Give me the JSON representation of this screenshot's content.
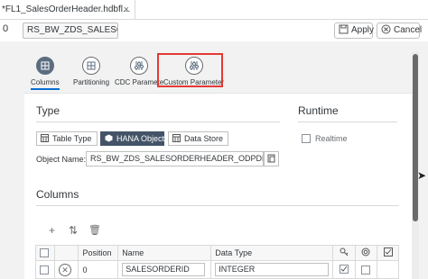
{
  "tab": {
    "title": "*FL1_SalesOrderHeader.hdbfl...",
    "close": "×"
  },
  "toolbar": {
    "row_number": "0",
    "name": "RS_BW_ZDS_SALESORD",
    "apply": "Apply",
    "cancel": "Cancel"
  },
  "icon_tabs": [
    {
      "label": "Columns",
      "icon": "grid-icon",
      "active": true
    },
    {
      "label": "Partitioning",
      "icon": "partition-icon",
      "active": false
    },
    {
      "label": "CDC Paramete",
      "icon": "sliders-icon",
      "active": false
    },
    {
      "label": "Custom Parameter",
      "icon": "sliders-icon",
      "active": false,
      "highlighted": true
    }
  ],
  "type_section": {
    "heading": "Type",
    "options": [
      {
        "label": "Table Type",
        "icon": "table-icon",
        "selected": false
      },
      {
        "label": "HANA Object",
        "icon": "cube-icon",
        "selected": true
      },
      {
        "label": "Data Store",
        "icon": "table-icon",
        "selected": false
      }
    ],
    "object_name_label": "Object Name:",
    "object_name_value": "RS_BW_ZDS_SALESORDERHEADER_ODPDEMO"
  },
  "runtime_section": {
    "heading": "Runtime",
    "realtime_label": "Realtime",
    "realtime_checked": false
  },
  "columns_section": {
    "heading": "Columns",
    "tools": [
      "add-icon",
      "sort-icon",
      "delete-icon"
    ],
    "table": {
      "headers": [
        "",
        "",
        "Position",
        "Name",
        "Data Type",
        "key-icon",
        "globe-icon",
        "check-icon"
      ],
      "rows": [
        {
          "position": "0",
          "name": "SALESORDERID",
          "data_type": "INTEGER"
        }
      ]
    }
  },
  "colors": {
    "accent": "#0a6ed1",
    "active_tab": "#5d6d80",
    "selected_segment": "#445468",
    "highlight_box": "#e53935"
  }
}
